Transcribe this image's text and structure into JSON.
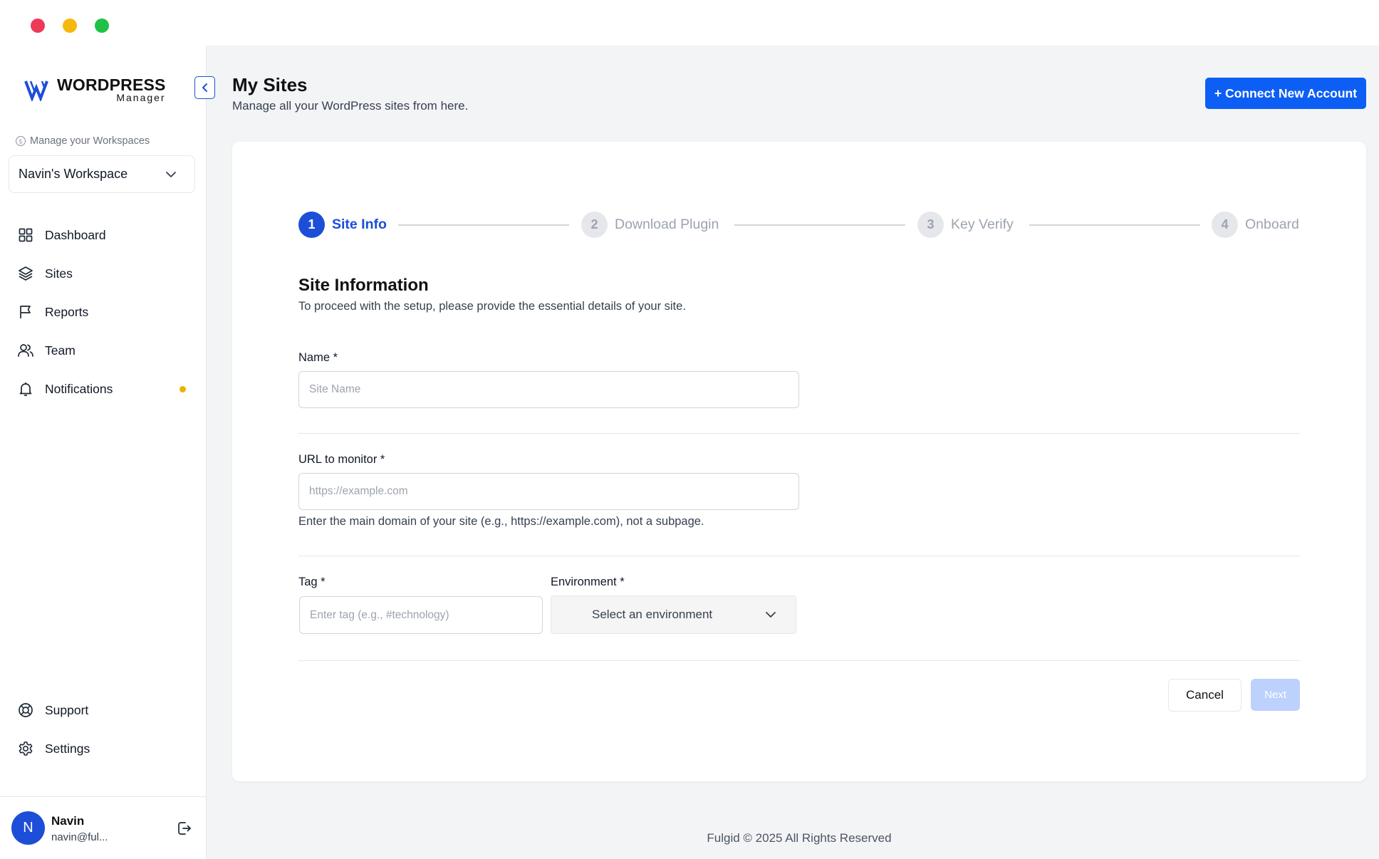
{
  "sidebar": {
    "logo": {
      "title": "WORDPRESS",
      "subtitle": "Manager"
    },
    "workspace_caption": "Manage your Workspaces",
    "workspace_selected": "Navin's Workspace",
    "nav": [
      {
        "label": "Dashboard",
        "icon": "grid-icon"
      },
      {
        "label": "Sites",
        "icon": "layers-icon"
      },
      {
        "label": "Reports",
        "icon": "flag-icon"
      },
      {
        "label": "Team",
        "icon": "users-icon"
      },
      {
        "label": "Notifications",
        "icon": "bell-icon",
        "badge_color": "#eab308"
      }
    ],
    "nav_bottom": [
      {
        "label": "Support",
        "icon": "lifebuoy-icon"
      },
      {
        "label": "Settings",
        "icon": "gear-icon"
      }
    ],
    "user": {
      "initial": "N",
      "name": "Navin",
      "email": "navin@ful..."
    }
  },
  "header": {
    "title": "My Sites",
    "subtitle": "Manage all your WordPress sites from here.",
    "connect_button": "+ Connect New Account"
  },
  "steps": [
    {
      "number": "1",
      "label": "Site Info",
      "active": true
    },
    {
      "number": "2",
      "label": "Download Plugin",
      "active": false
    },
    {
      "number": "3",
      "label": "Key Verify",
      "active": false
    },
    {
      "number": "4",
      "label": "Onboard",
      "active": false
    }
  ],
  "form": {
    "title": "Site Information",
    "description": "To proceed with the setup, please provide the essential details of your site.",
    "name": {
      "label": "Name *",
      "placeholder": "Site Name",
      "value": ""
    },
    "url": {
      "label": "URL to monitor *",
      "placeholder": "https://example.com",
      "value": "",
      "hint": "Enter the main domain of your site (e.g., https://example.com), not a subpage."
    },
    "tag": {
      "label": "Tag *",
      "placeholder": "Enter tag (e.g., #technology)",
      "value": ""
    },
    "environment": {
      "label": "Environment *",
      "selected": "Select an environment"
    },
    "cancel_label": "Cancel",
    "next_label": "Next"
  },
  "footer": {
    "text": "Fulgid © 2025 All Rights Reserved"
  },
  "colors": {
    "accent": "#1d4ed8",
    "button_primary": "#0d5ef5",
    "next_disabled": "#bcd1fb"
  }
}
